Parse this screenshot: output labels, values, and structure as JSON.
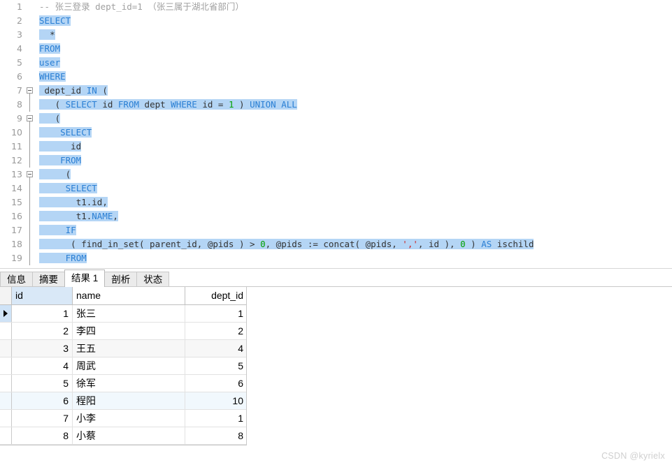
{
  "editor": {
    "name": "sql-editor",
    "lines": [
      {
        "num": "1",
        "fold": "none",
        "indent": 0,
        "selected": false,
        "tokens": [
          {
            "t": "-- 张三登录 dept_id=1 （张三属于湖北省部门）",
            "c": "cmt"
          }
        ]
      },
      {
        "num": "2",
        "fold": "none",
        "indent": 0,
        "selected": true,
        "caret": true,
        "tokens": [
          {
            "t": "SELECT",
            "c": "kw"
          }
        ]
      },
      {
        "num": "3",
        "fold": "none",
        "indent": 2,
        "selected": true,
        "tokens": [
          {
            "t": "*",
            "c": "plain"
          }
        ]
      },
      {
        "num": "4",
        "fold": "none",
        "indent": 0,
        "selected": true,
        "tokens": [
          {
            "t": "FROM",
            "c": "kw"
          }
        ]
      },
      {
        "num": "5",
        "fold": "none",
        "indent": 0,
        "selected": true,
        "tokens": [
          {
            "t": "user",
            "c": "kw"
          }
        ]
      },
      {
        "num": "6",
        "fold": "none",
        "indent": 0,
        "selected": true,
        "tokens": [
          {
            "t": "WHERE",
            "c": "kw"
          }
        ]
      },
      {
        "num": "7",
        "fold": "box-start",
        "indent": 1,
        "selected": true,
        "tokens": [
          {
            "t": "dept_id ",
            "c": "plain"
          },
          {
            "t": "IN",
            "c": "kw"
          },
          {
            "t": " (",
            "c": "plain"
          }
        ]
      },
      {
        "num": "8",
        "fold": "line",
        "indent": 3,
        "selected": true,
        "tokens": [
          {
            "t": "( ",
            "c": "plain"
          },
          {
            "t": "SELECT",
            "c": "kw"
          },
          {
            "t": " id ",
            "c": "plain"
          },
          {
            "t": "FROM",
            "c": "kw"
          },
          {
            "t": " dept ",
            "c": "plain"
          },
          {
            "t": "WHERE",
            "c": "kw"
          },
          {
            "t": " id = ",
            "c": "plain"
          },
          {
            "t": "1",
            "c": "num"
          },
          {
            "t": " ) ",
            "c": "plain"
          },
          {
            "t": "UNION ALL",
            "c": "kw"
          }
        ]
      },
      {
        "num": "9",
        "fold": "box-mid",
        "indent": 3,
        "selected": true,
        "tokens": [
          {
            "t": "(",
            "c": "plain"
          }
        ]
      },
      {
        "num": "10",
        "fold": "line",
        "indent": 4,
        "selected": true,
        "tokens": [
          {
            "t": "SELECT",
            "c": "kw"
          }
        ]
      },
      {
        "num": "11",
        "fold": "line",
        "indent": 6,
        "selected": true,
        "tokens": [
          {
            "t": "id",
            "c": "plain"
          }
        ]
      },
      {
        "num": "12",
        "fold": "line",
        "indent": 4,
        "selected": true,
        "tokens": [
          {
            "t": "FROM",
            "c": "kw"
          }
        ]
      },
      {
        "num": "13",
        "fold": "box-mid",
        "indent": 5,
        "selected": true,
        "tokens": [
          {
            "t": "(",
            "c": "plain"
          }
        ]
      },
      {
        "num": "14",
        "fold": "line",
        "indent": 5,
        "selected": true,
        "tokens": [
          {
            "t": "SELECT",
            "c": "kw"
          }
        ]
      },
      {
        "num": "15",
        "fold": "line",
        "indent": 7,
        "selected": true,
        "tokens": [
          {
            "t": "t1.id,",
            "c": "plain"
          }
        ]
      },
      {
        "num": "16",
        "fold": "line",
        "indent": 7,
        "selected": true,
        "tokens": [
          {
            "t": "t1.",
            "c": "plain"
          },
          {
            "t": "NAME",
            "c": "kw"
          },
          {
            "t": ",",
            "c": "plain"
          }
        ]
      },
      {
        "num": "17",
        "fold": "line",
        "indent": 5,
        "selected": true,
        "tokens": [
          {
            "t": "IF",
            "c": "kw"
          }
        ]
      },
      {
        "num": "18",
        "fold": "line",
        "indent": 6,
        "selected": true,
        "tokens": [
          {
            "t": "( find_in_set( parent_id, @pids ) > ",
            "c": "plain"
          },
          {
            "t": "0",
            "c": "num"
          },
          {
            "t": ", @pids := concat( @pids, ",
            "c": "plain"
          },
          {
            "t": "','",
            "c": "str"
          },
          {
            "t": ", id ), ",
            "c": "plain"
          },
          {
            "t": "0",
            "c": "num"
          },
          {
            "t": " ) ",
            "c": "plain"
          },
          {
            "t": "AS",
            "c": "kw"
          },
          {
            "t": " ischild",
            "c": "plain"
          }
        ]
      },
      {
        "num": "19",
        "fold": "line",
        "indent": 5,
        "selected": true,
        "tokens": [
          {
            "t": "FROM",
            "c": "kw"
          }
        ]
      }
    ]
  },
  "result_panel": {
    "tabs": [
      {
        "label": "信息",
        "active": false
      },
      {
        "label": "摘要",
        "active": false
      },
      {
        "label": "结果 1",
        "active": true
      },
      {
        "label": "剖析",
        "active": false
      },
      {
        "label": "状态",
        "active": false
      }
    ],
    "grid": {
      "columns": [
        "id",
        "name",
        "dept_id"
      ],
      "rows": [
        {
          "id": "1",
          "name": "张三",
          "dept_id": "1",
          "shade": "none",
          "current": true
        },
        {
          "id": "2",
          "name": "李四",
          "dept_id": "2",
          "shade": "none",
          "current": false
        },
        {
          "id": "3",
          "name": "王五",
          "dept_id": "4",
          "shade": "gray",
          "current": false
        },
        {
          "id": "4",
          "name": "周武",
          "dept_id": "5",
          "shade": "none",
          "current": false
        },
        {
          "id": "5",
          "name": "徐军",
          "dept_id": "6",
          "shade": "none",
          "current": false
        },
        {
          "id": "6",
          "name": "程阳",
          "dept_id": "10",
          "shade": "blue",
          "current": false
        },
        {
          "id": "7",
          "name": "小李",
          "dept_id": "1",
          "shade": "none",
          "current": false
        },
        {
          "id": "8",
          "name": "小蔡",
          "dept_id": "8",
          "shade": "none",
          "current": false
        }
      ]
    }
  },
  "watermark": {
    "text": "CSDN @kyrielx"
  },
  "colors": {
    "selection": "#b4d5f5",
    "keyword": "#2a7fd4",
    "number": "#00a000",
    "string": "#cc2222",
    "comment": "#a0a0a0",
    "header_accent": "#d9e8f7"
  }
}
